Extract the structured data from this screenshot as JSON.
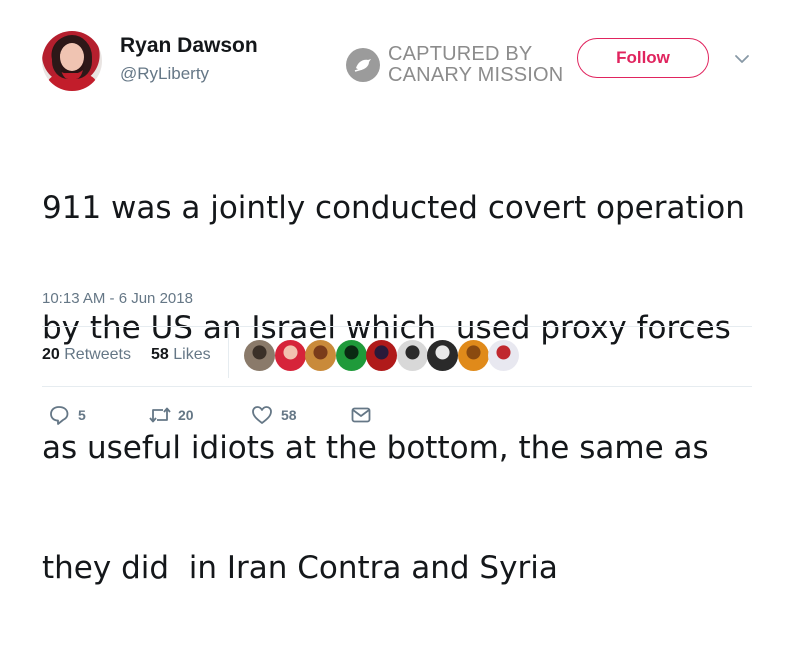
{
  "user": {
    "name": "Ryan Dawson",
    "handle": "@RyLiberty"
  },
  "watermark": {
    "line1": "CAPTURED BY",
    "line2": "CANARY MISSION"
  },
  "follow_label": "Follow",
  "tweet": {
    "lines": [
      "911 was a jointly conducted covert operation",
      "by the US an Israel which  used proxy forces",
      "as useful idiots at the bottom, the same as",
      "they did  in Iran Contra and Syria"
    ],
    "timestamp": "10:13 AM - 6 Jun 2018"
  },
  "stats": {
    "retweets_count": "20",
    "retweets_label": "Retweets",
    "likes_count": "58",
    "likes_label": "Likes"
  },
  "likers": [
    {
      "color": "#8a7a6a",
      "accent": "#3a3028"
    },
    {
      "color": "#d6243a",
      "accent": "#f2c2b0"
    },
    {
      "color": "#c98a3a",
      "accent": "#7a3c1a"
    },
    {
      "color": "#1f9a3a",
      "accent": "#0a2a12"
    },
    {
      "color": "#b01a1a",
      "accent": "#2a1a3a"
    },
    {
      "color": "#d8d8d8",
      "accent": "#2a2a2a"
    },
    {
      "color": "#2a2a2a",
      "accent": "#e8e8e8"
    },
    {
      "color": "#e08a1a",
      "accent": "#8a4a10"
    },
    {
      "color": "#e8e8f0",
      "accent": "#c0282e"
    }
  ],
  "actions": {
    "reply_count": "5",
    "retweet_count": "20",
    "like_count": "58"
  },
  "colors": {
    "follow_accent": "#e0245e",
    "secondary_text": "#657786",
    "watermark": "#8c8c8c"
  },
  "icons": {
    "watermark": "canary-bird-icon",
    "menu": "chevron-down-icon",
    "reply": "reply-icon",
    "retweet": "retweet-icon",
    "like": "heart-icon",
    "message": "envelope-icon"
  }
}
